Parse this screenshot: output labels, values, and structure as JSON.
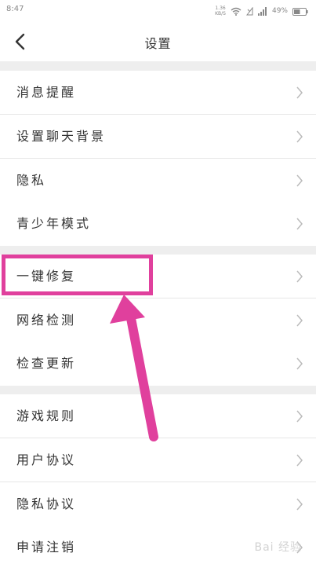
{
  "status_bar": {
    "time": "8:47",
    "net_speed_value": "1.36",
    "net_speed_unit": "KB/S",
    "battery": "49%"
  },
  "header": {
    "title": "设置",
    "back_icon": "chevron-left-icon"
  },
  "groups": [
    {
      "items": [
        {
          "label": "消息提醒"
        },
        {
          "label": "设置聊天背景"
        },
        {
          "label": "隐私"
        },
        {
          "label": "青少年模式"
        }
      ]
    },
    {
      "items": [
        {
          "label": "一键修复"
        },
        {
          "label": "网络检测"
        },
        {
          "label": "检查更新"
        }
      ]
    },
    {
      "items": [
        {
          "label": "游戏规则"
        },
        {
          "label": "用户协议"
        },
        {
          "label": "隐私协议"
        },
        {
          "label": "申请注销"
        }
      ]
    }
  ],
  "annotation": {
    "highlight_color": "#e0409d",
    "highlighted_item": "一键修复"
  },
  "watermark": "Bai 经验"
}
